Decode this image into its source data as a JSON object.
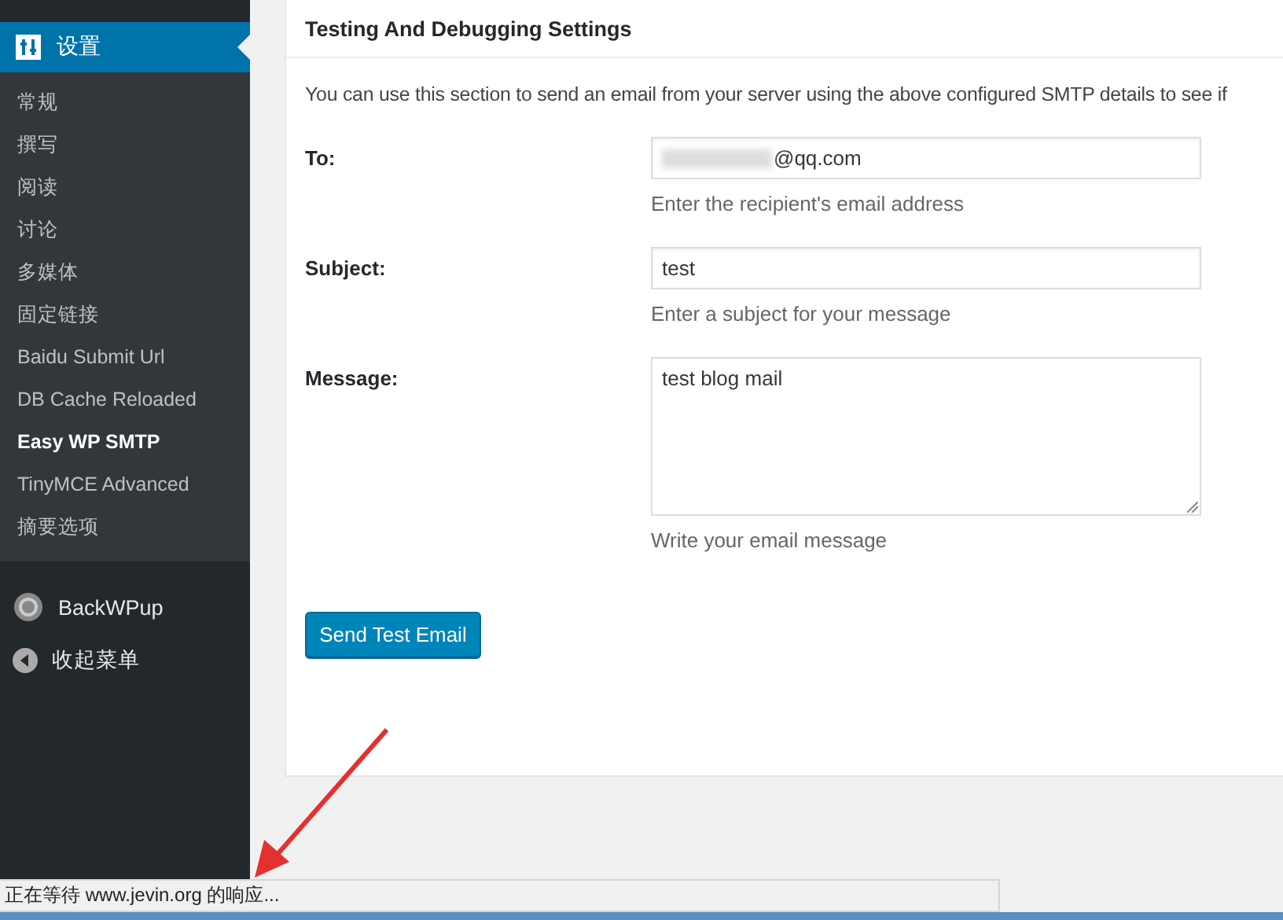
{
  "sidebar": {
    "active_item": {
      "label": "设置",
      "selected": true
    },
    "submenu": [
      {
        "label": "常规",
        "selected": false
      },
      {
        "label": "撰写",
        "selected": false
      },
      {
        "label": "阅读",
        "selected": false
      },
      {
        "label": "讨论",
        "selected": false
      },
      {
        "label": "多媒体",
        "selected": false
      },
      {
        "label": "固定链接",
        "selected": false
      },
      {
        "label": "Baidu Submit Url",
        "selected": false
      },
      {
        "label": "DB Cache Reloaded",
        "selected": false
      },
      {
        "label": "Easy WP SMTP",
        "selected": true
      },
      {
        "label": "TinyMCE Advanced",
        "selected": false
      },
      {
        "label": "摘要选项",
        "selected": false
      }
    ],
    "items": [
      {
        "kind": "plugin",
        "label": "BackWPup"
      },
      {
        "kind": "collapse",
        "label": "收起菜单"
      }
    ]
  },
  "panel": {
    "title": "Testing And Debugging Settings",
    "description": "You can use this section to send an email from your server using the above configured SMTP details to see if",
    "fields": [
      {
        "kind": "input",
        "label": "To:",
        "value": "@qq.com",
        "redacted": true,
        "hint": "Enter the recipient's email address"
      },
      {
        "kind": "input",
        "label": "Subject:",
        "value": "test",
        "hint": "Enter a subject for your message"
      },
      {
        "kind": "textarea",
        "label": "Message:",
        "value": "test blog mail",
        "hint": "Write your email message"
      }
    ],
    "button": "Send Test Email"
  },
  "status_bar": {
    "text": "正在等待 www.jevin.org 的响应..."
  }
}
